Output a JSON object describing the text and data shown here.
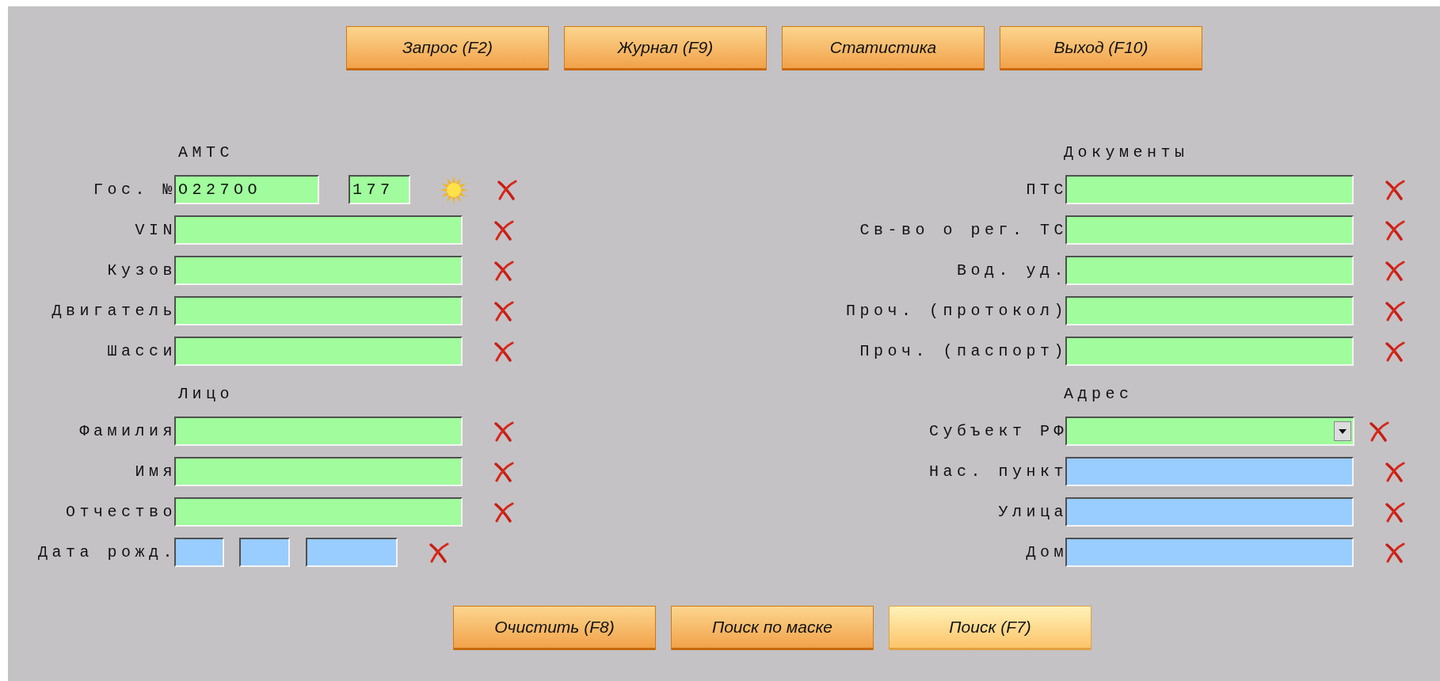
{
  "toolbar": [
    {
      "label": "Запрос (F2)"
    },
    {
      "label": "Журнал (F9)"
    },
    {
      "label": "Статистика"
    },
    {
      "label": "Выход (F10)"
    }
  ],
  "columns": [
    {
      "sections": [
        {
          "title": "АМТС",
          "rows": [
            {
              "kind": "plate",
              "label": "Гос. №",
              "inputs": [
                {
                  "kind": "plate",
                  "value": "O227OO",
                  "color": "#a0fc9c"
                },
                {
                  "kind": "region",
                  "value": "177",
                  "color": "#a0fc9c"
                }
              ]
            },
            {
              "kind": "field",
              "label": "VIN",
              "inputs": [
                {
                  "kind": "text",
                  "color": "#a0fc9c"
                }
              ]
            },
            {
              "kind": "field",
              "label": "Кузов",
              "inputs": [
                {
                  "kind": "text",
                  "color": "#a0fc9c"
                }
              ]
            },
            {
              "kind": "field",
              "label": "Двигатель",
              "inputs": [
                {
                  "kind": "text",
                  "color": "#a0fc9c"
                }
              ]
            },
            {
              "kind": "field",
              "label": "Шасси",
              "inputs": [
                {
                  "kind": "text",
                  "color": "#a0fc9c"
                }
              ]
            }
          ]
        },
        {
          "title": "Лицо",
          "rows": [
            {
              "kind": "field",
              "label": "Фамилия",
              "inputs": [
                {
                  "kind": "text",
                  "color": "#a0fc9c"
                }
              ]
            },
            {
              "kind": "field",
              "label": "Имя",
              "inputs": [
                {
                  "kind": "text",
                  "color": "#a0fc9c"
                }
              ]
            },
            {
              "kind": "field",
              "label": "Отчество",
              "inputs": [
                {
                  "kind": "text",
                  "color": "#a0fc9c"
                }
              ]
            },
            {
              "kind": "date",
              "label": "Дата рожд.",
              "inputs": [
                {
                  "kind": "day",
                  "color": "#99ccff"
                },
                {
                  "kind": "month",
                  "color": "#99ccff"
                },
                {
                  "kind": "year",
                  "color": "#99ccff"
                }
              ]
            }
          ]
        }
      ]
    },
    {
      "sections": [
        {
          "title": "Документы",
          "rows": [
            {
              "kind": "field",
              "label": "ПТС",
              "inputs": [
                {
                  "kind": "text",
                  "color": "#a0fc9c"
                }
              ]
            },
            {
              "kind": "field",
              "label": "Св-во о рег. ТС",
              "inputs": [
                {
                  "kind": "text",
                  "color": "#a0fc9c"
                }
              ]
            },
            {
              "kind": "field",
              "label": "Вод. уд.",
              "inputs": [
                {
                  "kind": "text",
                  "color": "#a0fc9c"
                }
              ]
            },
            {
              "kind": "field",
              "label": "Проч. (протокол)",
              "inputs": [
                {
                  "kind": "text",
                  "color": "#a0fc9c"
                }
              ]
            },
            {
              "kind": "field",
              "label": "Проч. (паспорт)",
              "inputs": [
                {
                  "kind": "text",
                  "color": "#a0fc9c"
                }
              ]
            }
          ]
        },
        {
          "title": "Адрес",
          "rows": [
            {
              "kind": "select",
              "label": "Субъект РФ",
              "inputs": [
                {
                  "kind": "select",
                  "color": "#a0fc9c"
                }
              ]
            },
            {
              "kind": "field",
              "label": "Нас. пункт",
              "inputs": [
                {
                  "kind": "text",
                  "color": "#99ccff"
                }
              ]
            },
            {
              "kind": "field",
              "label": "Улица",
              "inputs": [
                {
                  "kind": "text",
                  "color": "#99ccff"
                }
              ]
            },
            {
              "kind": "field",
              "label": "Дом",
              "inputs": [
                {
                  "kind": "text",
                  "color": "#99ccff"
                }
              ]
            }
          ]
        }
      ]
    }
  ],
  "actions": [
    {
      "label": "Очистить (F8)",
      "focused": false
    },
    {
      "label": "Поиск по маске",
      "focused": false
    },
    {
      "label": "Поиск (F7)",
      "focused": true
    }
  ]
}
